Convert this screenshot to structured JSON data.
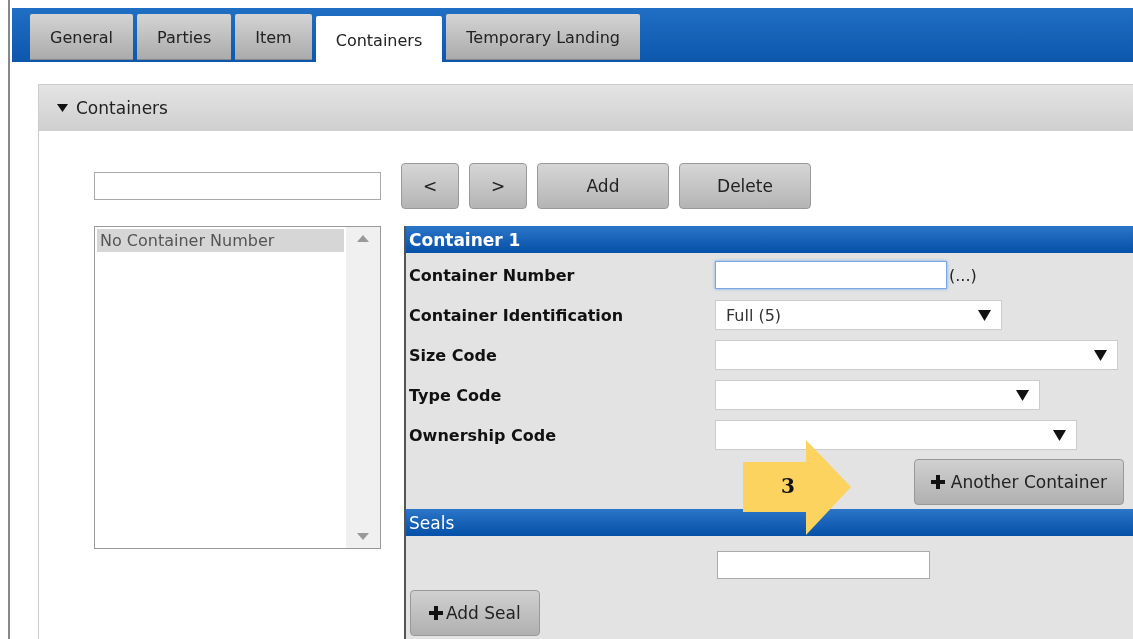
{
  "tabs": [
    {
      "label": "General",
      "selected": false
    },
    {
      "label": "Parties",
      "selected": false
    },
    {
      "label": "Item",
      "selected": false
    },
    {
      "label": "Containers",
      "selected": true
    },
    {
      "label": "Temporary Landing",
      "selected": false
    }
  ],
  "section": {
    "title": "Containers",
    "expanded": true
  },
  "toolbar": [
    "<",
    ">",
    "Add",
    "Delete"
  ],
  "list": {
    "items": [
      {
        "label": "No Container Number",
        "selected": true
      }
    ]
  },
  "container": {
    "title": "Container 1",
    "fields": [
      {
        "label": "Container Number",
        "kind": "text",
        "focused": true,
        "suffix": "(...)"
      },
      {
        "label": "Container Identification",
        "kind": "select",
        "value": "Full (5)"
      },
      {
        "label": "Size Code",
        "kind": "select"
      },
      {
        "label": "Type Code",
        "kind": "select"
      },
      {
        "label": "Ownership Code",
        "kind": "select"
      }
    ],
    "add_button": "Another Container"
  },
  "seals": {
    "title": "Seals",
    "add_button": "Add Seal"
  },
  "callout": {
    "number": "3"
  }
}
